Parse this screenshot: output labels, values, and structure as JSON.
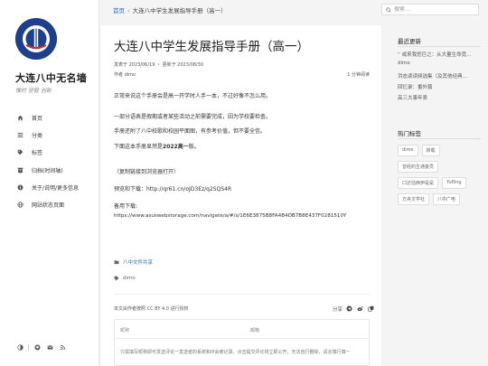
{
  "site": {
    "title": "大连八中无名墙",
    "subtitle": "惟时 坚毅 创新"
  },
  "nav": [
    {
      "label": "首页",
      "icon": "home-icon"
    },
    {
      "label": "分类",
      "icon": "list-icon"
    },
    {
      "label": "标签",
      "icon": "tag-icon"
    },
    {
      "label": "归档(时间轴)",
      "icon": "archive-icon"
    },
    {
      "label": "关于/说明/更多信息",
      "icon": "info-icon"
    },
    {
      "label": "网站状态页面",
      "icon": "globe-icon"
    }
  ],
  "breadcrumb": {
    "home": "首页",
    "separator": "›",
    "current": "大连八中学生发展指导手册（高一）"
  },
  "search": {
    "placeholder": "搜索..."
  },
  "article": {
    "title": "大连八中学生发展指导手册（高一）",
    "meta_published": "发表于 2023/06/19 ・ 更新于 2023/08/30",
    "meta_author": "作者 dimo",
    "read_time": "1 分钟阅读",
    "p1": "正常来说这个手册会是高一开学时人手一本，不过好像不怎么用。",
    "p2": "一部分语表是假期或者某些活动之前需要完成，因为学校要检查。",
    "p3": "手册还附了八中校歌和校园平面图，有参考价值，但不要全信。",
    "p4_prefix": "下面这本手册显然是",
    "p4_bold": "2022高一",
    "p4_suffix": "版。",
    "copy_hint": "（复制链接到浏览器打开）",
    "preview_label": "预览和下载：http://qr61.cn/oJD3Ez/q2SQS4R",
    "backup_label": "备用下载:",
    "backup_url": "https://www.asuswebstorage.com/navigate/a/#/s/1E6E3875B8FA4B4DB7B8E437F0281510Y",
    "category": "八中文件共享",
    "tag": "dimo",
    "license": "本文由作者按照 CC BY 4.0 进行授权",
    "share_label": "分享"
  },
  "comment": {
    "nick_placeholder": "昵称",
    "mail_placeholder": "邮箱",
    "text": "只需填写昵称即可发送评论一发送者的系统和IP会被记录。点击提交评论将立即公开，无法自行删除，请言慎行慎一"
  },
  "right": {
    "recent_title": "最近更新",
    "recent": [
      "“ 或来我挖巨之：从大量生命竟…",
      "dimo",
      "洪态读读频选集（及其他经典…",
      "回忆录：番外篇",
      "高三大事年表"
    ],
    "tags_title": "热门标签",
    "tags": [
      "dimo",
      "转载",
      "曾经的生通委员",
      "口达估西伊是是",
      "Yufling",
      "方舟文学社",
      "八中广电"
    ]
  }
}
